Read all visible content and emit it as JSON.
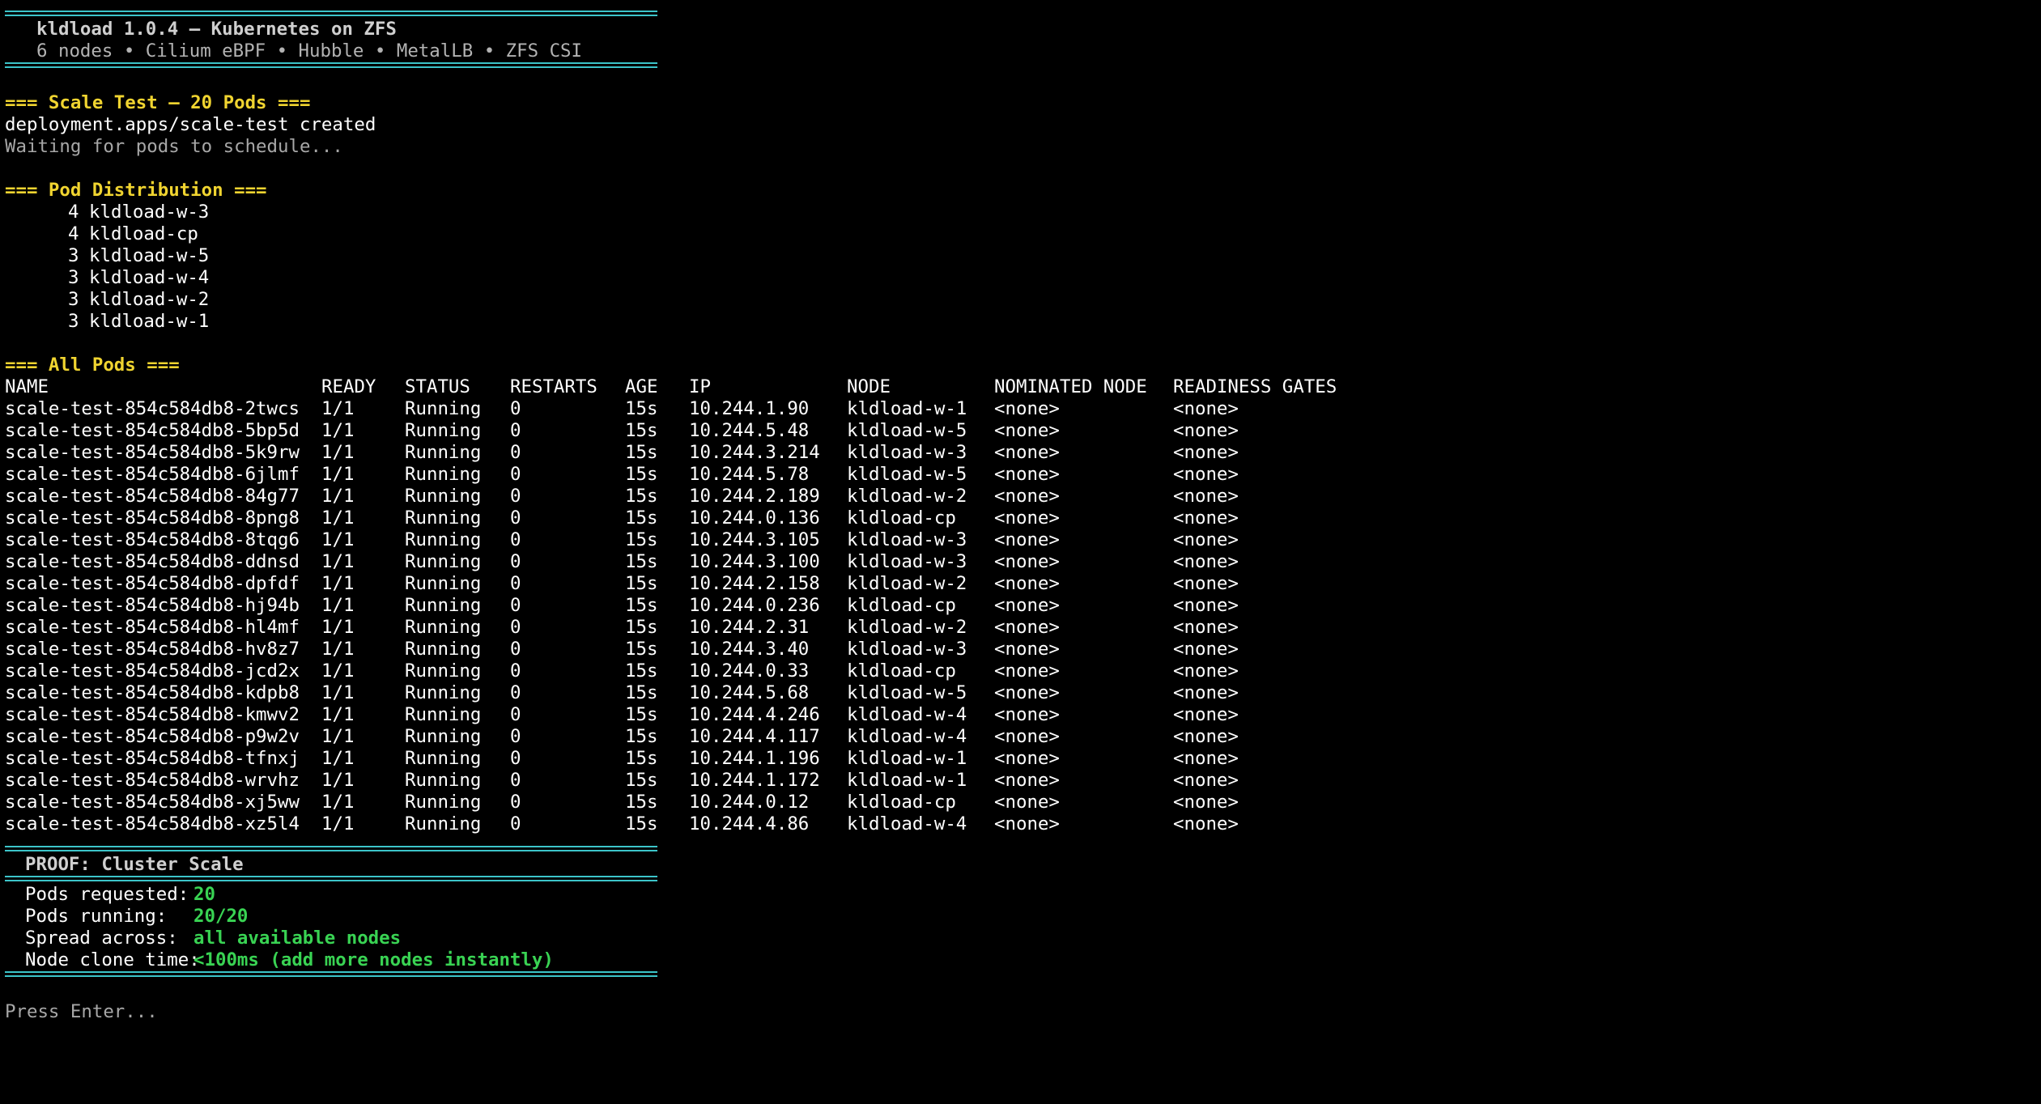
{
  "banner": {
    "title": "kldload 1.0.4 — Kubernetes on ZFS",
    "subtitle": "6 nodes • Cilium eBPF • Hubble • MetalLB • ZFS CSI"
  },
  "scale_test": {
    "header": "=== Scale Test — 20 Pods ===",
    "created_msg": "deployment.apps/scale-test created",
    "waiting_msg": "Waiting for pods to schedule..."
  },
  "distribution": {
    "header": "=== Pod Distribution ===",
    "rows": [
      {
        "count": "4",
        "node": "kldload-w-3"
      },
      {
        "count": "4",
        "node": "kldload-cp"
      },
      {
        "count": "3",
        "node": "kldload-w-5"
      },
      {
        "count": "3",
        "node": "kldload-w-4"
      },
      {
        "count": "3",
        "node": "kldload-w-2"
      },
      {
        "count": "3",
        "node": "kldload-w-1"
      }
    ]
  },
  "pods": {
    "header": "=== All Pods ===",
    "columns": [
      "NAME",
      "READY",
      "STATUS",
      "RESTARTS",
      "AGE",
      "IP",
      "NODE",
      "NOMINATED NODE",
      "READINESS GATES"
    ],
    "rows": [
      [
        "scale-test-854c584db8-2twcs",
        "1/1",
        "Running",
        "0",
        "15s",
        "10.244.1.90",
        "kldload-w-1",
        "<none>",
        "<none>"
      ],
      [
        "scale-test-854c584db8-5bp5d",
        "1/1",
        "Running",
        "0",
        "15s",
        "10.244.5.48",
        "kldload-w-5",
        "<none>",
        "<none>"
      ],
      [
        "scale-test-854c584db8-5k9rw",
        "1/1",
        "Running",
        "0",
        "15s",
        "10.244.3.214",
        "kldload-w-3",
        "<none>",
        "<none>"
      ],
      [
        "scale-test-854c584db8-6jlmf",
        "1/1",
        "Running",
        "0",
        "15s",
        "10.244.5.78",
        "kldload-w-5",
        "<none>",
        "<none>"
      ],
      [
        "scale-test-854c584db8-84g77",
        "1/1",
        "Running",
        "0",
        "15s",
        "10.244.2.189",
        "kldload-w-2",
        "<none>",
        "<none>"
      ],
      [
        "scale-test-854c584db8-8png8",
        "1/1",
        "Running",
        "0",
        "15s",
        "10.244.0.136",
        "kldload-cp",
        "<none>",
        "<none>"
      ],
      [
        "scale-test-854c584db8-8tqg6",
        "1/1",
        "Running",
        "0",
        "15s",
        "10.244.3.105",
        "kldload-w-3",
        "<none>",
        "<none>"
      ],
      [
        "scale-test-854c584db8-ddnsd",
        "1/1",
        "Running",
        "0",
        "15s",
        "10.244.3.100",
        "kldload-w-3",
        "<none>",
        "<none>"
      ],
      [
        "scale-test-854c584db8-dpfdf",
        "1/1",
        "Running",
        "0",
        "15s",
        "10.244.2.158",
        "kldload-w-2",
        "<none>",
        "<none>"
      ],
      [
        "scale-test-854c584db8-hj94b",
        "1/1",
        "Running",
        "0",
        "15s",
        "10.244.0.236",
        "kldload-cp",
        "<none>",
        "<none>"
      ],
      [
        "scale-test-854c584db8-hl4mf",
        "1/1",
        "Running",
        "0",
        "15s",
        "10.244.2.31",
        "kldload-w-2",
        "<none>",
        "<none>"
      ],
      [
        "scale-test-854c584db8-hv8z7",
        "1/1",
        "Running",
        "0",
        "15s",
        "10.244.3.40",
        "kldload-w-3",
        "<none>",
        "<none>"
      ],
      [
        "scale-test-854c584db8-jcd2x",
        "1/1",
        "Running",
        "0",
        "15s",
        "10.244.0.33",
        "kldload-cp",
        "<none>",
        "<none>"
      ],
      [
        "scale-test-854c584db8-kdpb8",
        "1/1",
        "Running",
        "0",
        "15s",
        "10.244.5.68",
        "kldload-w-5",
        "<none>",
        "<none>"
      ],
      [
        "scale-test-854c584db8-kmwv2",
        "1/1",
        "Running",
        "0",
        "15s",
        "10.244.4.246",
        "kldload-w-4",
        "<none>",
        "<none>"
      ],
      [
        "scale-test-854c584db8-p9w2v",
        "1/1",
        "Running",
        "0",
        "15s",
        "10.244.4.117",
        "kldload-w-4",
        "<none>",
        "<none>"
      ],
      [
        "scale-test-854c584db8-tfnxj",
        "1/1",
        "Running",
        "0",
        "15s",
        "10.244.1.196",
        "kldload-w-1",
        "<none>",
        "<none>"
      ],
      [
        "scale-test-854c584db8-wrvhz",
        "1/1",
        "Running",
        "0",
        "15s",
        "10.244.1.172",
        "kldload-w-1",
        "<none>",
        "<none>"
      ],
      [
        "scale-test-854c584db8-xj5ww",
        "1/1",
        "Running",
        "0",
        "15s",
        "10.244.0.12",
        "kldload-cp",
        "<none>",
        "<none>"
      ],
      [
        "scale-test-854c584db8-xz5l4",
        "1/1",
        "Running",
        "0",
        "15s",
        "10.244.4.86",
        "kldload-w-4",
        "<none>",
        "<none>"
      ]
    ]
  },
  "proof": {
    "title": "PROOF: Cluster Scale",
    "items": [
      {
        "label": "Pods requested:",
        "value": "20"
      },
      {
        "label": "Pods running:",
        "value": "20/20"
      },
      {
        "label": "Spread across:",
        "value": "all available nodes"
      },
      {
        "label": "Node clone time:",
        "value": "<100ms (add more nodes instantly)"
      }
    ]
  },
  "prompt": "Press Enter...",
  "colors": {
    "background": "#000000",
    "rule": "#3cc4c9",
    "header": "#f0d430",
    "value": "#39d353",
    "dim": "#a7a7a7"
  }
}
